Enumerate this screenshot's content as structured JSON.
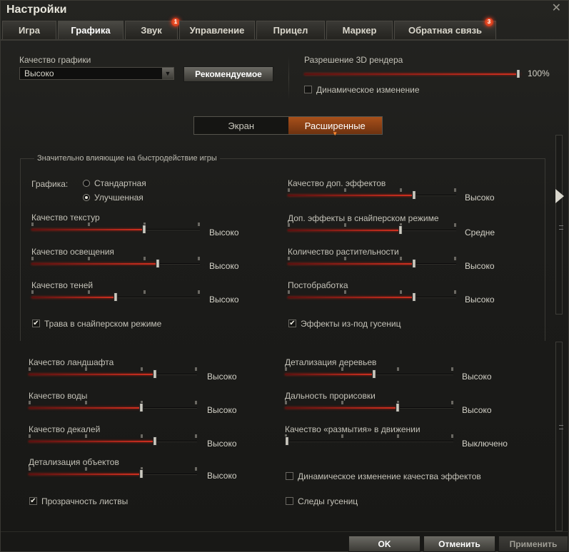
{
  "window": {
    "title": "Настройки",
    "close": "✕"
  },
  "tabs": [
    {
      "label": "Игра",
      "badge": ""
    },
    {
      "label": "Графика",
      "badge": ""
    },
    {
      "label": "Звук",
      "badge": "1"
    },
    {
      "label": "Управление",
      "badge": ""
    },
    {
      "label": "Прицел",
      "badge": ""
    },
    {
      "label": "Маркер",
      "badge": ""
    },
    {
      "label": "Обратная связь",
      "badge": "3"
    }
  ],
  "quality": {
    "label": "Качество графики",
    "value": "Высоко",
    "recommended": "Рекомендуемое"
  },
  "render": {
    "label": "Разрешение 3D рендера",
    "value": "100%",
    "level": 1.0,
    "dynamic_label": "Динамическое изменение",
    "dynamic_checked": false
  },
  "subtabs": [
    "Экран",
    "Расширенные"
  ],
  "group": {
    "title": "Значительно влияющие на быстродействие игры",
    "graphics_label": "Графика:",
    "options": [
      "Стандартная",
      "Улучшенная"
    ]
  },
  "settings": [
    {
      "label": "Качество текстур",
      "value": "Высоко",
      "level": 0.67
    },
    {
      "label": "Качество освещения",
      "value": "Высоко",
      "level": 0.75
    },
    {
      "label": "Качество теней",
      "value": "Высоко",
      "level": 0.5
    },
    {
      "label": "Качество доп. эффектов",
      "value": "Высоко",
      "level": 0.75
    },
    {
      "label": "Доп. эффекты в снайперском режиме",
      "value": "Средне",
      "level": 0.67
    },
    {
      "label": "Количество растительности",
      "value": "Высоко",
      "level": 0.75
    },
    {
      "label": "Постобработка",
      "value": "Высоко",
      "level": 0.75
    },
    {
      "label": "Качество ландшафта",
      "value": "Высоко",
      "level": 0.75
    },
    {
      "label": "Качество воды",
      "value": "Высоко",
      "level": 0.67
    },
    {
      "label": "Качество декалей",
      "value": "Высоко",
      "level": 0.75
    },
    {
      "label": "Детализация объектов",
      "value": "Высоко",
      "level": 0.67
    },
    {
      "label": "Детализация деревьев",
      "value": "Высоко",
      "level": 0.53
    },
    {
      "label": "Дальность прорисовки",
      "value": "Высоко",
      "level": 0.67
    },
    {
      "label": "Качество «размытия» в движении",
      "value": "Выключено",
      "level": 0.0
    }
  ],
  "checks": [
    {
      "label": "Трава в снайперском режиме",
      "checked": true
    },
    {
      "label": "Эффекты из-под гусениц",
      "checked": true
    },
    {
      "label": "Динамическое изменение качества эффектов",
      "checked": false
    },
    {
      "label": "Прозрачность листвы",
      "checked": true
    },
    {
      "label": "Следы гусениц",
      "checked": false
    }
  ],
  "footer": {
    "ok": "OK",
    "cancel": "Отменить",
    "apply": "Применить"
  }
}
